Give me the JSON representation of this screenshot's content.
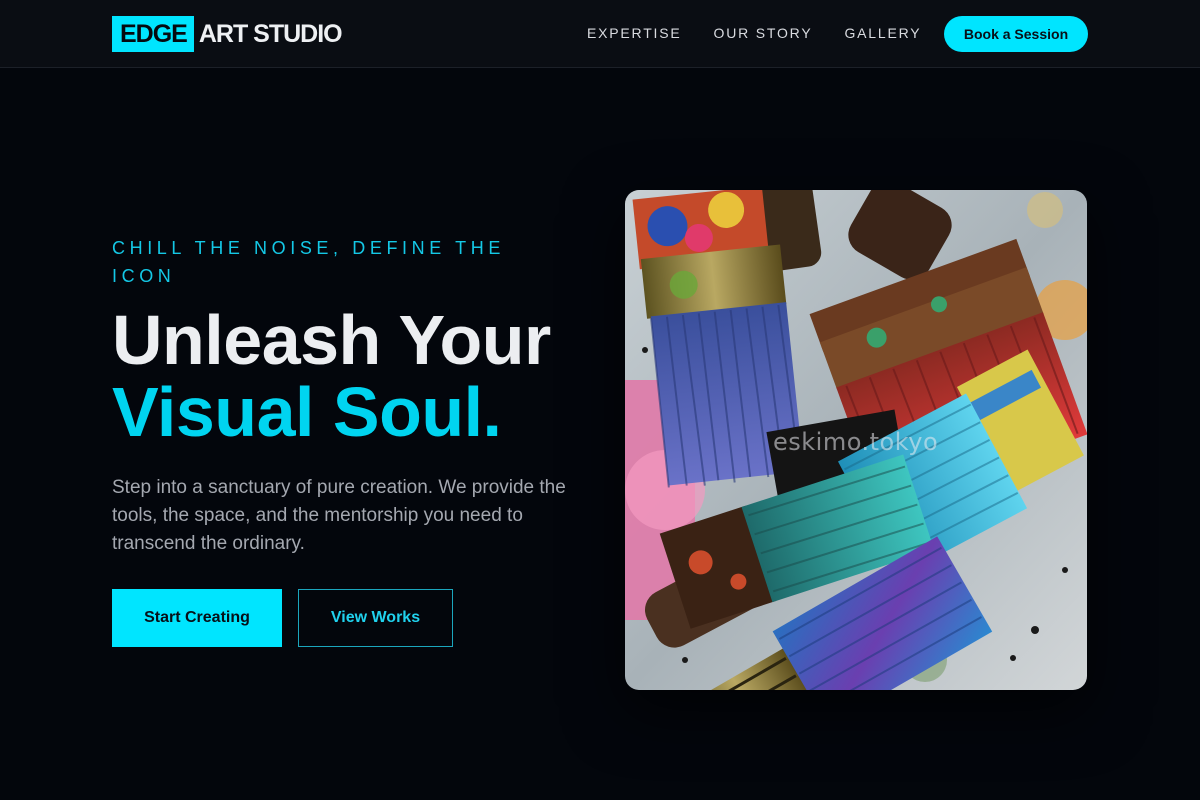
{
  "brand": {
    "badge": "EDGE",
    "name": "ART STUDIO",
    "accent_color": "#00e5ff"
  },
  "nav": {
    "items": [
      {
        "label": "EXPERTISE"
      },
      {
        "label": "OUR STORY"
      },
      {
        "label": "GALLERY"
      }
    ],
    "cta_label": "Book a Session"
  },
  "hero": {
    "eyebrow": "CHILL THE NOISE, DEFINE THE ICON",
    "headline_line1": "Unleash Your",
    "headline_line2": "Visual Soul.",
    "lede": "Step into a sanctuary of pure creation. We provide the tools, the space, and the mentorship you need to transcend the ordinary.",
    "primary_button": "Start Creating",
    "secondary_button": "View Works",
    "image": {
      "subject": "paintbrushes-with-colorful-paint",
      "watermark": "eskimo.tokyo"
    }
  }
}
